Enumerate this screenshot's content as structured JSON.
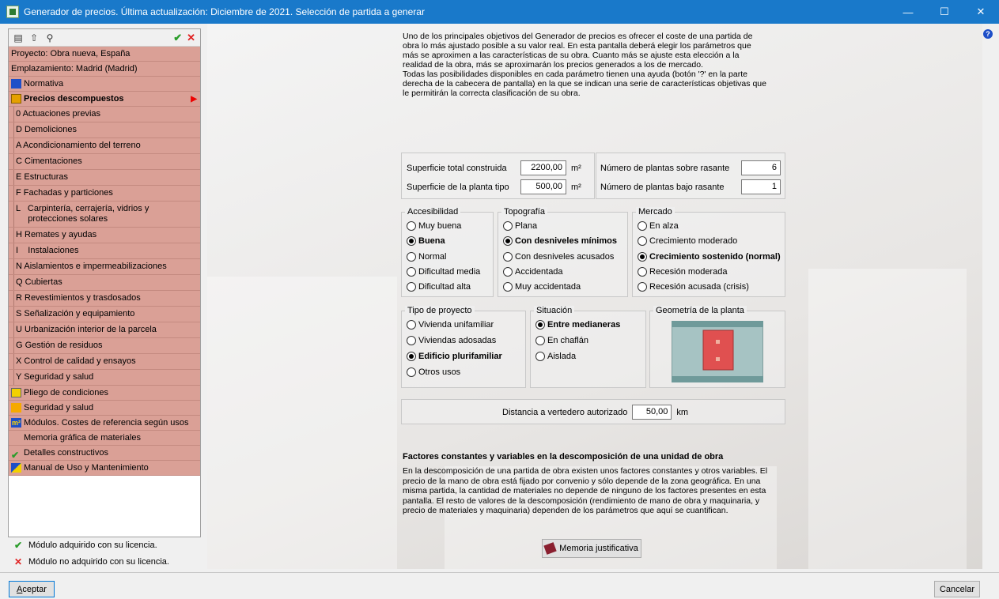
{
  "window": {
    "title": "Generador de precios. Última actualización: Diciembre de 2021. Selección de partida a generar",
    "controls": [
      "—",
      "☐",
      "✕"
    ]
  },
  "colors": {
    "titlebar": "#1979ca",
    "tree_bg": "#daa096",
    "accent_red": "#e05050"
  },
  "sidebar": {
    "toolbar_icons": [
      "list-icon",
      "up-icon",
      "binoculars-icon",
      "check-icon",
      "cross-icon"
    ],
    "items": [
      {
        "label": "Proyecto: Obra nueva, España"
      },
      {
        "label": "Emplazamiento: Madrid (Madrid)"
      },
      {
        "label": "Normativa",
        "icon": "normativa-icon"
      },
      {
        "label": "Precios descompuestos",
        "icon": "precios-icon",
        "selected": true
      },
      {
        "label": "0   Actuaciones previas"
      },
      {
        "label": "D   Demoliciones"
      },
      {
        "label": "A   Acondicionamiento del terreno"
      },
      {
        "label": "C   Cimentaciones"
      },
      {
        "label": "E   Estructuras"
      },
      {
        "label": "F   Fachadas y particiones"
      },
      {
        "label": "L   Carpintería, cerrajería, vidrios y"
      },
      {
        "label": "     protecciones solares"
      },
      {
        "label": "H   Remates y ayudas"
      },
      {
        "label": "I    Instalaciones"
      },
      {
        "label": "N   Aislamientos e impermeabilizaciones"
      },
      {
        "label": "Q   Cubiertas"
      },
      {
        "label": "R   Revestimientos y trasdosados"
      },
      {
        "label": "S   Señalización y equipamiento"
      },
      {
        "label": "U   Urbanización interior de la parcela"
      },
      {
        "label": "G   Gestión de residuos"
      },
      {
        "label": "X   Control de calidad y ensayos"
      },
      {
        "label": "Y   Seguridad y salud"
      },
      {
        "label": "Pliego de condiciones",
        "icon": "pliego-icon"
      },
      {
        "label": "Seguridad y salud",
        "icon": "seguridad-icon"
      },
      {
        "label": "Módulos. Costes de referencia según usos",
        "icon": "modulos-icon"
      },
      {
        "label": "Memoria gráfica de materiales"
      },
      {
        "label": "Detalles constructivos",
        "icon": "check-icon"
      },
      {
        "label": "Manual de Uso y Mantenimiento",
        "icon": "manual-icon"
      }
    ],
    "legend_ok": "Módulo adquirido con su licencia.",
    "legend_no": "Módulo no adquirido con su licencia."
  },
  "intro": {
    "lines": [
      "Uno de los principales objetivos del Generador de precios es ofrecer el coste de una partida de",
      "obra lo más ajustado posible a su valor real. En esta pantalla deberá elegir los parámetros que",
      "más se aproximen a las características de su obra. Cuanto más se ajuste esta elección a la",
      "realidad de la obra, más se aproximarán los precios generados a los de mercado.",
      "Todas las posibilidades disponibles en cada parámetro tienen una ayuda (botón '?' en la parte",
      "derecha de la cabecera de pantalla) en la que se indican una serie de características objetivas que",
      "le permitirán la correcta clasificación de su obra."
    ]
  },
  "surfaces": {
    "total_label": "Superficie total construida",
    "total_value": "2200,00",
    "tipo_label": "Superficie de la planta tipo",
    "tipo_value": "500,00",
    "unit": "m²"
  },
  "floors": {
    "above_label": "Número de plantas sobre rasante",
    "above_value": "6",
    "below_label": "Número de plantas bajo rasante",
    "below_value": "1"
  },
  "accesibilidad": {
    "title": "Accesibilidad",
    "options": [
      "Muy buena",
      "Buena",
      "Normal",
      "Dificultad media",
      "Dificultad alta"
    ],
    "selected": "Buena"
  },
  "topografia": {
    "title": "Topografía",
    "options": [
      "Plana",
      "Con desniveles mínimos",
      "Con desniveles acusados",
      "Accidentada",
      "Muy accidentada"
    ],
    "selected": "Con desniveles mínimos"
  },
  "mercado": {
    "title": "Mercado",
    "options": [
      "En alza",
      "Crecimiento moderado",
      "Crecimiento sostenido (normal)",
      "Recesión moderada",
      "Recesión acusada (crisis)"
    ],
    "selected": "Crecimiento sostenido (normal)"
  },
  "tipo_proyecto": {
    "title": "Tipo de proyecto",
    "options": [
      "Vivienda unifamiliar",
      "Viviendas adosadas",
      "Edificio plurifamiliar",
      "Otros usos"
    ],
    "selected": "Edificio plurifamiliar"
  },
  "situacion": {
    "title": "Situación",
    "options": [
      "Entre medianeras",
      "En chaflán",
      "Aislada"
    ],
    "selected": "Entre medianeras"
  },
  "geometria": {
    "title": "Geometría de la planta"
  },
  "distancia": {
    "label": "Distancia a vertedero autorizado",
    "value": "50,00",
    "unit": "km"
  },
  "factores": {
    "title": "Factores constantes y variables en la descomposición de una unidad de obra",
    "lines": [
      "En la descomposición de una partida de obra existen unos factores constantes y otros variables. El",
      "precio de la mano de obra está fijado por convenio y sólo depende de la zona geográfica. En una",
      "misma partida, la cantidad de materiales no depende de ninguno de los factores presentes en esta",
      "pantalla. El resto de valores de la descomposición (rendimiento de mano de obra y maquinaria, y",
      "precio de materiales y maquinaria) dependen de los parámetros que aquí se cuantifican."
    ]
  },
  "buttons": {
    "memoria": "Memoria justificativa",
    "aceptar_first": "A",
    "aceptar_rest": "ceptar",
    "cancelar": "Cancelar"
  }
}
